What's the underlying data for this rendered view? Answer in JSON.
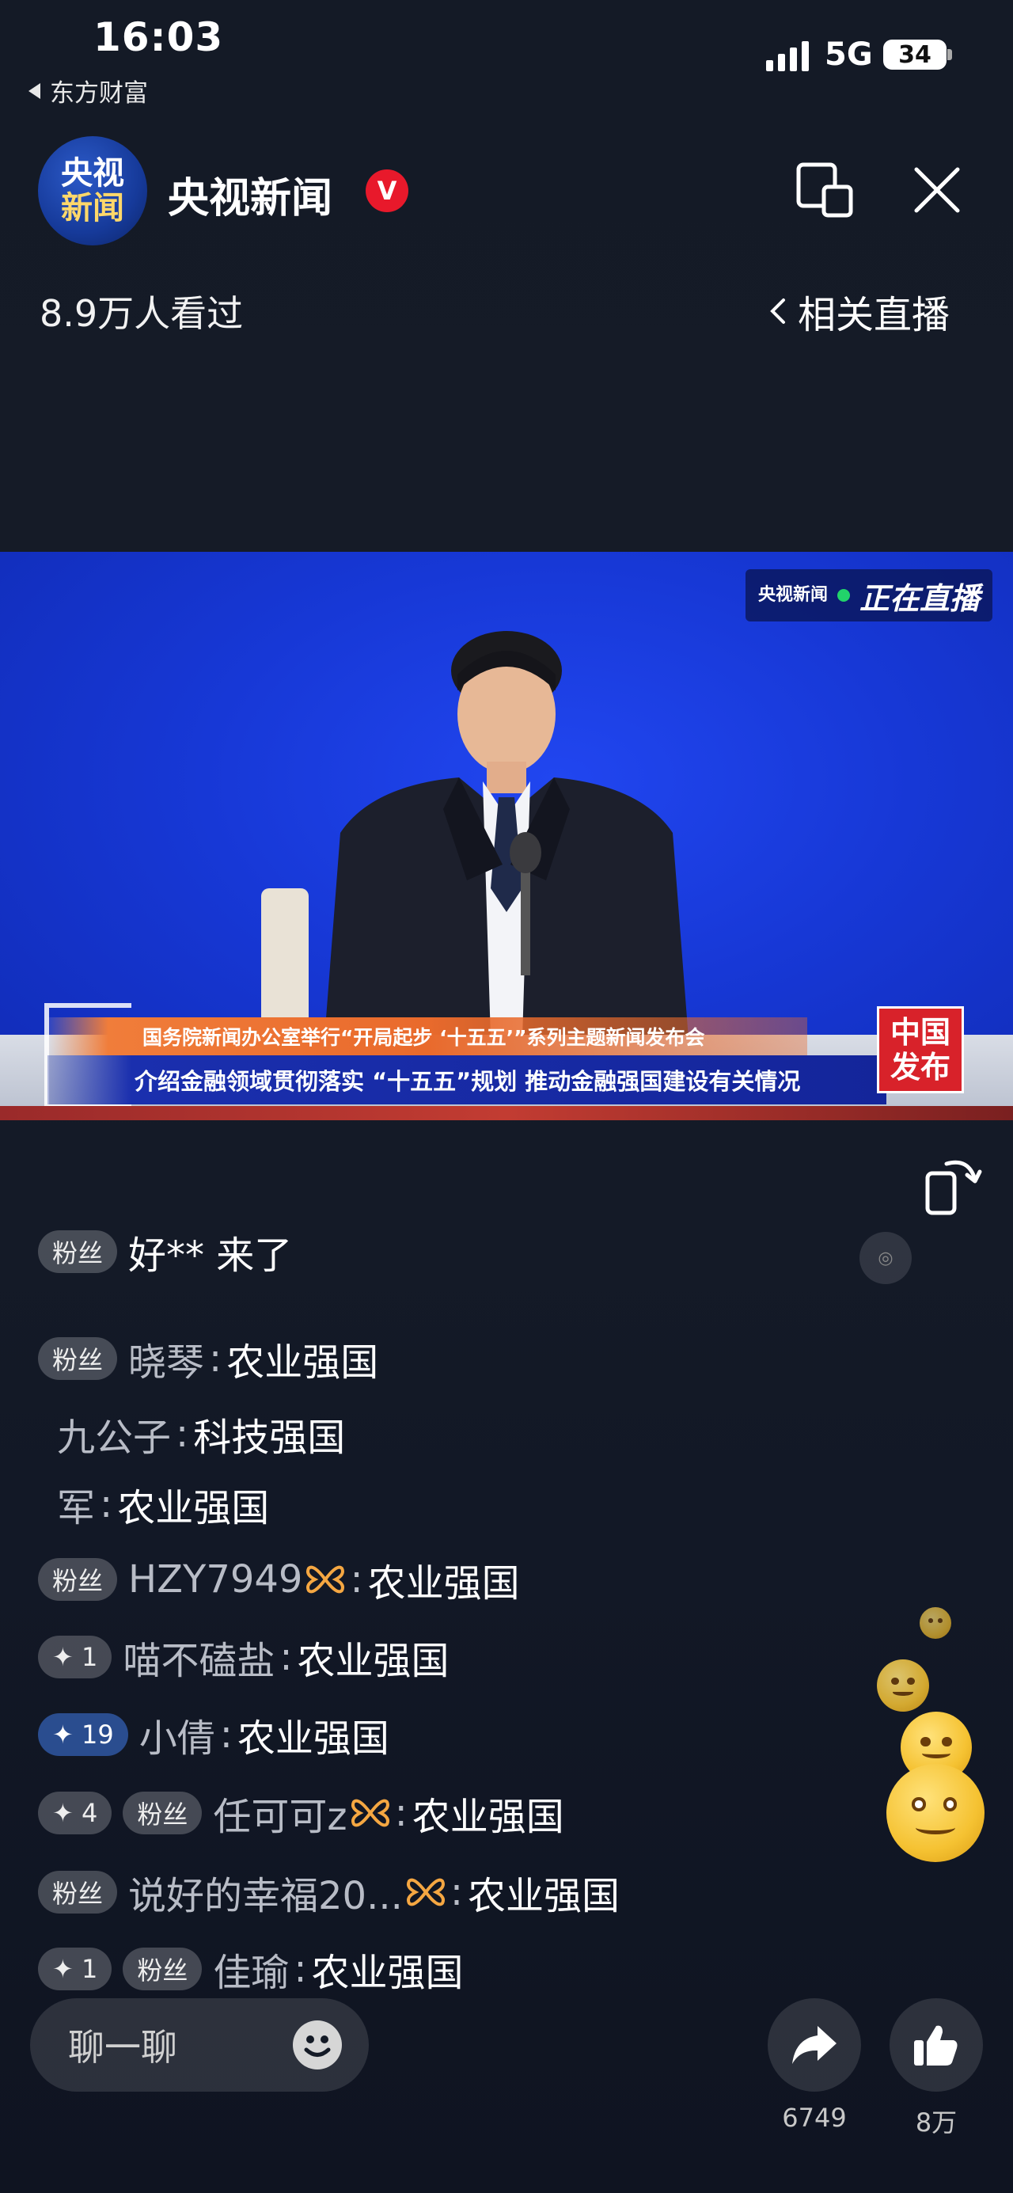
{
  "status_bar": {
    "time": "16:03",
    "back_app": "东方财富",
    "network": "5G",
    "battery": "34"
  },
  "header": {
    "channel_name": "央视新闻",
    "logo_line1": "央视",
    "logo_line2": "新闻",
    "verified_mark": "V",
    "viewer_count": "8.9万人看过",
    "related_live": "相关直播"
  },
  "video": {
    "live_badge_brand": "央视新闻",
    "live_badge_text": "正在直播",
    "banner_line1": "国务院新闻办公室举行“开局起步 ‘十五五’”系列主题新闻发布会",
    "banner_line2": "介绍金融领域贯彻落实 “十五五”规划 推动金融强国建设有关情况",
    "corner_logo_line1": "中国",
    "corner_logo_line2": "发布"
  },
  "chat": {
    "welcome": {
      "badge": "粉丝",
      "text": "好** 来了"
    },
    "subscribe_icon": "subscribe-icon",
    "messages": [
      {
        "level": "",
        "badge": "粉丝",
        "name": "晓琴",
        "message": "农业强国",
        "butterfly": false
      },
      {
        "level": "",
        "badge": "",
        "name": "九公子",
        "message": "科技强国",
        "butterfly": false
      },
      {
        "level": "",
        "badge": "",
        "name": "军",
        "message": "农业强国",
        "butterfly": false
      },
      {
        "level": "",
        "badge": "粉丝",
        "name": "HZY7949",
        "message": "农业强国",
        "butterfly": true
      },
      {
        "level": "+1",
        "badge": "",
        "name": "喵不磕盐",
        "message": "农业强国",
        "butterfly": false
      },
      {
        "level": "19",
        "badge": "",
        "name": "小倩",
        "message": "农业强国",
        "butterfly": false
      },
      {
        "level": "+4",
        "badge": "粉丝",
        "name": "任可可z",
        "message": "农业强国",
        "butterfly": true
      },
      {
        "level": "",
        "badge": "粉丝",
        "name": "说好的幸福20...",
        "message": "农业强国",
        "butterfly": true
      },
      {
        "level": "+1",
        "badge": "粉丝",
        "name": "佳瑜",
        "message": "农业强国",
        "butterfly": false
      }
    ]
  },
  "bottom_bar": {
    "input_label": "聊一聊",
    "share_count": "6749",
    "like_count": "8万"
  },
  "colors": {
    "background": "#141a26",
    "video_blue": "#1738d6",
    "banner_orange": "#e96a2c",
    "verified_red": "#e8192b",
    "butterfly_orange": "#f5a742"
  }
}
